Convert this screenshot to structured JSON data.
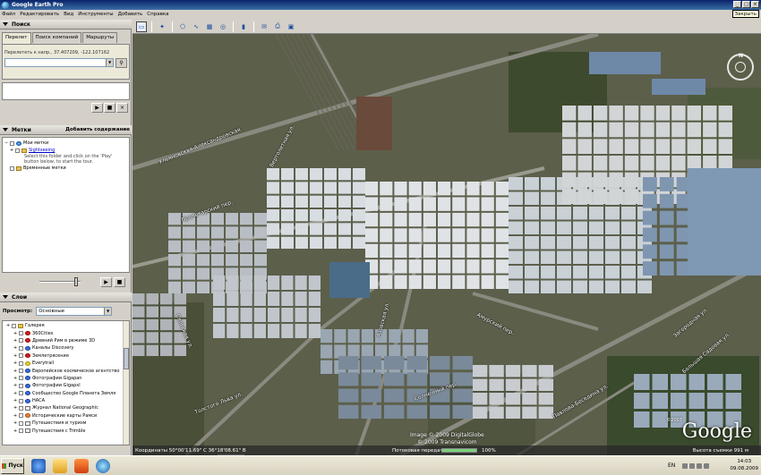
{
  "window": {
    "title": "Google Earth Pro",
    "close_tooltip": "Закрыть"
  },
  "menu": [
    "Файл",
    "Редактировать",
    "Вид",
    "Инструменты",
    "Добавить",
    "Справка"
  ],
  "search": {
    "header": "Поиск",
    "tabs": [
      "Перелет",
      "Поиск компаний",
      "Маршруты"
    ],
    "hint": "Перелететь к напр., 37.407209, -122.107162",
    "input_value": ""
  },
  "places": {
    "header": "Метки",
    "add_content": "Добавить содержание",
    "items": [
      {
        "label": "Мои метки"
      },
      {
        "label": "Sightseeing"
      },
      {
        "label": "Временные метки"
      }
    ],
    "sightseeing_desc": "Select this folder and click on the 'Play' button below, to start the tour."
  },
  "layers": {
    "header": "Слои",
    "viewer_label": "Просмотр:",
    "viewer_value": "Основные",
    "items": [
      {
        "label": "Галерея",
        "icon": "folder-icon"
      },
      {
        "label": "360Cities",
        "icon": "red"
      },
      {
        "label": "Древний Рим в режиме 3D",
        "icon": "red"
      },
      {
        "label": "Каналы Discovery",
        "icon": "blue"
      },
      {
        "label": "Землетрясения",
        "icon": "red"
      },
      {
        "label": "Everytrail",
        "icon": "yellow"
      },
      {
        "label": "Европейское космическое агентство",
        "icon": "blue"
      },
      {
        "label": "Фотографии Gigapan",
        "icon": "blue"
      },
      {
        "label": "Фотографии Gigapxl",
        "icon": "blue"
      },
      {
        "label": "Сообщество Google Планета Земля",
        "icon": "blue"
      },
      {
        "label": "НАСА",
        "icon": "blue"
      },
      {
        "label": "Журнал National Geographic",
        "icon": "doc"
      },
      {
        "label": "Исторические карты Рамси",
        "icon": "orange"
      },
      {
        "label": "Путешествия и туризм",
        "icon": "doc"
      },
      {
        "label": "Путешествия с Trimble",
        "icon": "doc"
      }
    ]
  },
  "map": {
    "streets": [
      "Ульяновская-Александровская",
      "Пролетарский пер.",
      "Вертолетная ул.",
      "Сельская ул.",
      "Толстого Льва ул.",
      "Азовская ул.",
      "Амурский пер.",
      "Солнечный пер.",
      "Павлова-Беседина ул.",
      "Загородная ул.",
      "Большая Садовая ул."
    ],
    "copyright_line1": "Image © 2009 DigitalGlobe",
    "copyright_line2": "© 2009 Transnavicom",
    "google_year": "©2007",
    "google_logo": "Google",
    "compass_n": "N"
  },
  "status": {
    "coords": "Координаты   50°00'11.69\" С    36°18'08.61\" В",
    "streaming_label": "Потоковая передача",
    "streaming_pct": "100%",
    "streaming_fraction": 1.0,
    "altitude": "Высота съемки    991 м"
  },
  "taskbar": {
    "start": "Пуск",
    "lang": "EN",
    "time": "14:03",
    "date": "09.08.2009"
  }
}
